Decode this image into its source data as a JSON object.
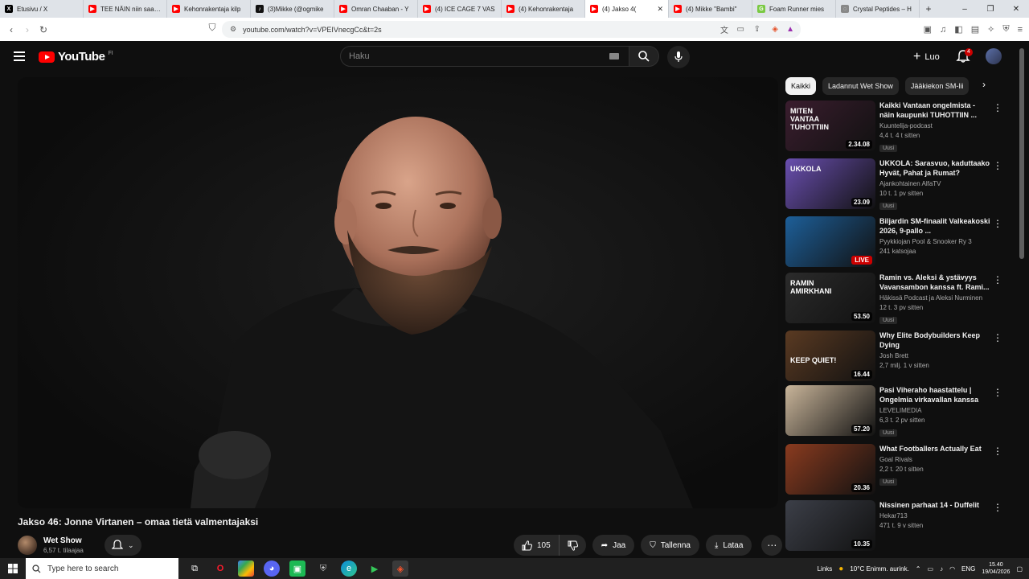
{
  "browser": {
    "tabs": [
      {
        "title": "Etusivu / X",
        "favicon_color": "#000000",
        "glyph": "X"
      },
      {
        "title": "TEE NÄIN niin saat F",
        "favicon_color": "#ff0000",
        "glyph": "▶"
      },
      {
        "title": "Kehonrakentaja kilp",
        "favicon_color": "#ff0000",
        "glyph": "▶"
      },
      {
        "title": "(3)Mikke (@ogmike",
        "favicon_color": "#111111",
        "glyph": "♪"
      },
      {
        "title": "Omran Chaaban - Y",
        "favicon_color": "#ff0000",
        "glyph": "▶"
      },
      {
        "title": "(4) ICE CAGE 7 VAS",
        "favicon_color": "#ff0000",
        "glyph": "▶"
      },
      {
        "title": "(4) Kehonrakentaja",
        "favicon_color": "#ff0000",
        "glyph": "▶"
      },
      {
        "title": "(4) Jakso 4(",
        "favicon_color": "#ff0000",
        "glyph": "▶",
        "active": true
      },
      {
        "title": "(4) Mikke \"Bambi\"",
        "favicon_color": "#ff0000",
        "glyph": "▶"
      },
      {
        "title": "Foam Runner mies",
        "favicon_color": "#7ac943",
        "glyph": "G"
      },
      {
        "title": "Crystal Peptides – H",
        "favicon_color": "#888888",
        "glyph": "◌"
      }
    ],
    "url": "youtube.com/watch?v=VPEIVnecgCc&t=2s"
  },
  "youtube": {
    "logo_text": "YouTube",
    "country_code": "FI",
    "search_placeholder": "Haku",
    "create_label": "Luo",
    "notification_count": "4"
  },
  "video": {
    "title": "Jakso 46: Jonne Virtanen – omaa tietä valmentajaksi",
    "channel": "Wet Show",
    "subscribers": "6,57 t. tilaajaa",
    "likes": "105",
    "share_label": "Jaa",
    "save_label": "Tallenna",
    "download_label": "Lataa"
  },
  "chips": [
    "Kaikki",
    "Ladannut Wet Show",
    "Jääkiekon SM-lii"
  ],
  "recommendations": [
    {
      "title": "Kaikki Vantaan ongelmista - näin kaupunki TUHOTTIIN ...",
      "channel": "Kuuntelija-podcast",
      "meta": "4,4 t.  4 t sitten",
      "badge": "Uusi",
      "duration": "2.34.08",
      "thumb_text": "MITEN VANTAA TUHOTTIIN",
      "bg": "#3a1d2e"
    },
    {
      "title": "UKKOLA: Sarasvuo, kaduttaako Hyvät, Pahat ja Rumat?",
      "channel": "Ajankohtainen AlfaTV",
      "meta": "10 t.  1 pv sitten",
      "badge": "Uusi",
      "duration": "23.09",
      "thumb_text": "UKKOLA",
      "bg": "#6a4fb0"
    },
    {
      "title": "Biljardin SM-finaalit Valkeakoski 2026, 9-pallo ...",
      "channel": "Pyykkiojan Pool & Snooker Ry 3",
      "meta": "241 katsojaa",
      "badge": "",
      "duration": "LIVE",
      "thumb_text": "",
      "bg": "#1d5f99"
    },
    {
      "title": "Ramin vs. Aleksi & ystävyys Vavansambon kanssa ft. Rami...",
      "channel": "Häkissä Podcast ja Aleksi Nurminen",
      "meta": "12 t.  3 pv sitten",
      "badge": "Uusi",
      "duration": "53.50",
      "thumb_text": "RAMIN AMIRKHANI",
      "bg": "#2b2b2b"
    },
    {
      "title": "Why Elite Bodybuilders Keep Dying",
      "channel": "Josh Brett",
      "meta": "2,7 milj.  1 v sitten",
      "badge": "",
      "duration": "16.44",
      "thumb_text": "KEEP QUIET!",
      "bg": "#5a3a22"
    },
    {
      "title": "Pasi Viheraho haastattelu | Ongelmia virkavallan kanssa",
      "channel": "LEVELIMEDIA",
      "meta": "6,3 t.  2 pv sitten",
      "badge": "Uusi",
      "duration": "57.20",
      "thumb_text": "",
      "bg": "#c9b59a"
    },
    {
      "title": "What Footballers Actually Eat",
      "channel": "Goal Rivals",
      "meta": "2,2 t.  20 t sitten",
      "badge": "Uusi",
      "duration": "20.36",
      "thumb_text": "",
      "bg": "#8a3b1f"
    },
    {
      "title": "Nissinen parhaat 14 - Duffelit",
      "channel": "Hekar713",
      "meta": "471 t.  9 v sitten",
      "badge": "",
      "duration": "10.35",
      "thumb_text": "",
      "bg": "#3c3f48"
    }
  ],
  "taskbar": {
    "search_placeholder": "Type here to search",
    "links": "Links",
    "weather": "10°C  Enimm. aurink.",
    "lang": "ENG",
    "time": "15.40",
    "date": "19/04/2026"
  },
  "colors": {
    "accent": "#ff0000",
    "bg": "#0f0f0f",
    "chip": "#272727"
  }
}
